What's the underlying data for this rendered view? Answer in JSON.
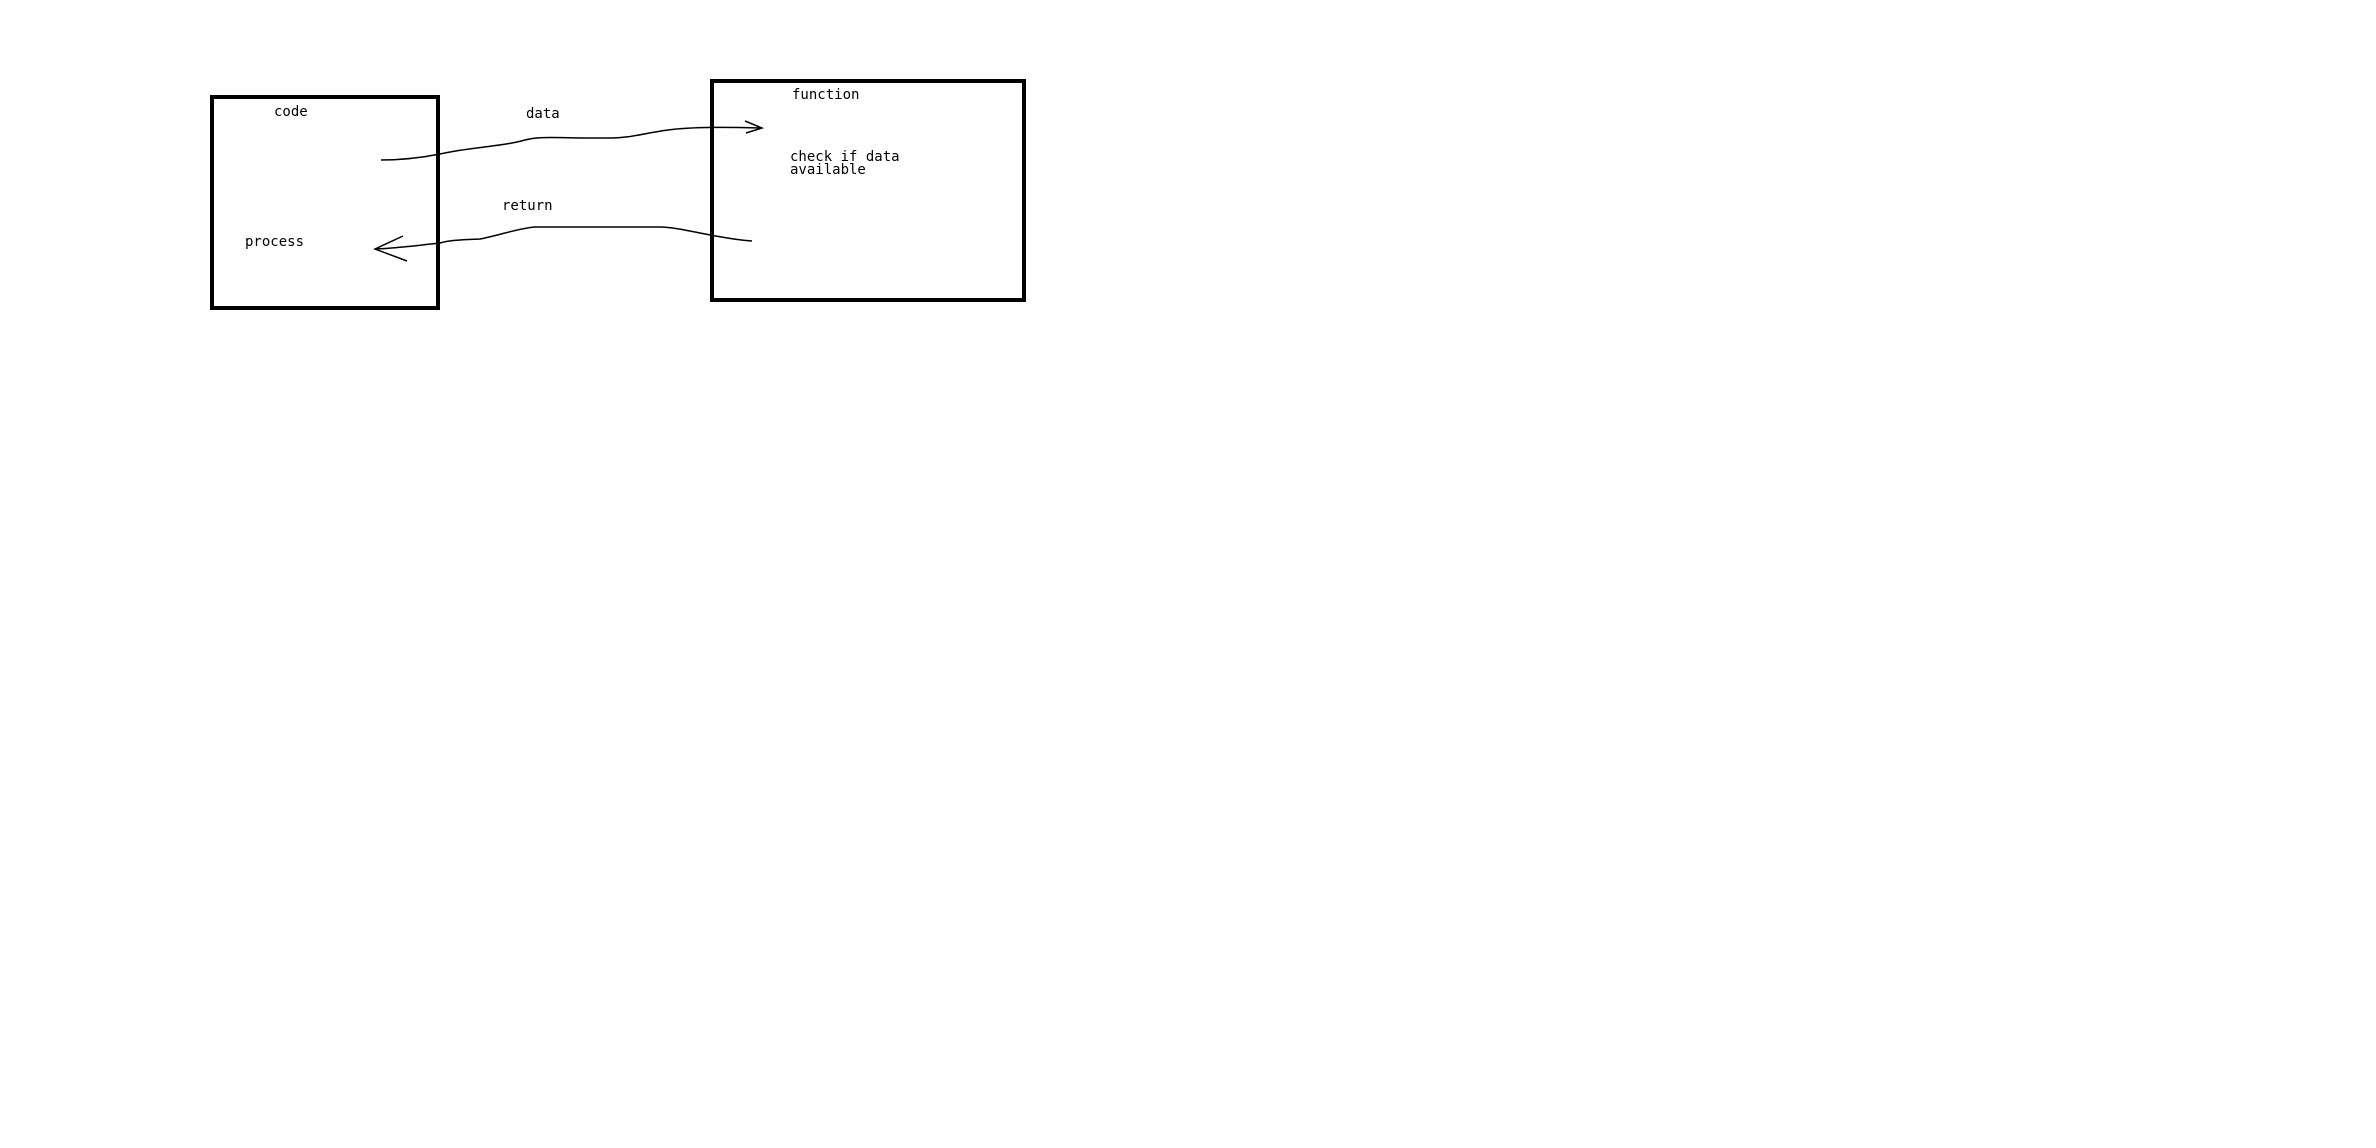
{
  "diagram": {
    "nodes": [
      {
        "id": "code",
        "title": "code",
        "body": "process"
      },
      {
        "id": "function",
        "title": "function",
        "body_lines": [
          "check if data",
          "available"
        ]
      }
    ],
    "edges": [
      {
        "from": "code",
        "to": "function",
        "label": "data"
      },
      {
        "from": "function",
        "to": "code",
        "label": "return"
      }
    ]
  },
  "colors": {
    "stroke": "#000000",
    "background": "#ffffff"
  }
}
